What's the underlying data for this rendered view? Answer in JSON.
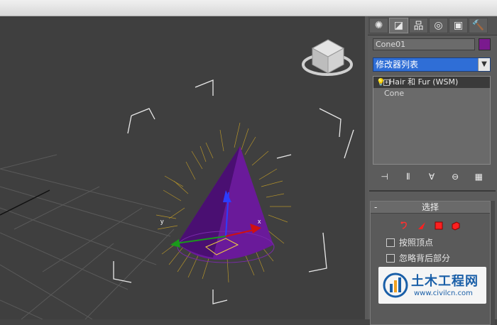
{
  "command_panel": {
    "tabs": [
      {
        "icon": "create-icon",
        "glyph": "✺"
      },
      {
        "icon": "modify-icon",
        "glyph": "◪"
      },
      {
        "icon": "hierarchy-icon",
        "glyph": "品"
      },
      {
        "icon": "motion-icon",
        "glyph": "◎"
      },
      {
        "icon": "display-icon",
        "glyph": "▣"
      },
      {
        "icon": "utilities-icon",
        "glyph": "🔨"
      }
    ],
    "object_name": "Cone01",
    "object_color": "#7a1a8e",
    "modifier_list_label": "修改器列表",
    "stack": [
      {
        "label": "Hair 和 Fur (WSM)",
        "selected": true
      },
      {
        "label": "Cone",
        "selected": false
      }
    ],
    "stack_tools": [
      "⊣",
      "⫴",
      "∀",
      "⊖",
      "▦"
    ],
    "selection_rollout": {
      "title": "选择",
      "checkbox_1": "按照顶点",
      "checkbox_2": "忽略背后部分"
    }
  },
  "viewport": {
    "accent_cone": "#6a1a9a",
    "hair_color": "#c9a227"
  },
  "watermark": {
    "title": "土木工程网",
    "url": "www.civilcn.com"
  }
}
